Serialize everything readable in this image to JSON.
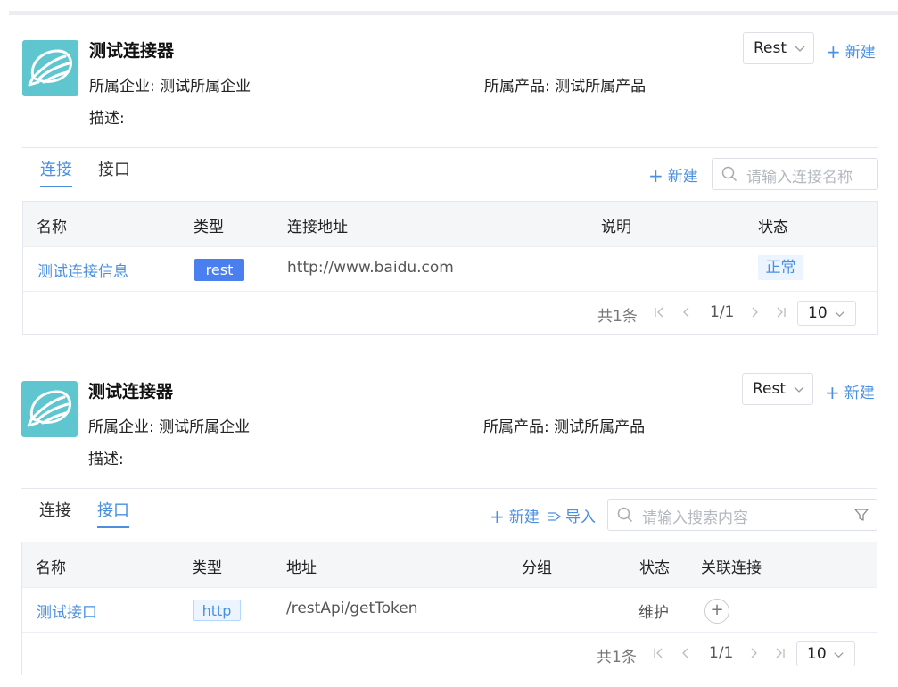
{
  "cards": [
    {
      "title": "测试连接器",
      "company": "所属企业: 测试所属企业",
      "product": "所属产品: 测试所属产品",
      "description": "描述:",
      "type_select": "Rest",
      "new_label": "新建",
      "tabs": [
        "连接",
        "接口"
      ],
      "active_tab": "连接",
      "search_placeholder": "请输入连接名称",
      "columns": [
        "名称",
        "类型",
        "连接地址",
        "说明",
        "状态"
      ],
      "rows": [
        {
          "name": "测试连接信息",
          "type": "rest",
          "address": "http://www.baidu.com",
          "note": "",
          "status": "正常"
        }
      ],
      "pagination": {
        "total": "共1条",
        "page": "1/1",
        "page_size": "10"
      }
    },
    {
      "title": "测试连接器",
      "company": "所属企业: 测试所属企业",
      "product": "所属产品: 测试所属产品",
      "description": "描述:",
      "type_select": "Rest",
      "new_label": "新建",
      "tabs": [
        "连接",
        "接口"
      ],
      "active_tab": "接口",
      "import_label": "导入",
      "search_placeholder": "请输入搜索内容",
      "columns": [
        "名称",
        "类型",
        "地址",
        "分组",
        "状态",
        "关联连接"
      ],
      "rows": [
        {
          "name": "测试接口",
          "type": "http",
          "address": "/restApi/getToken",
          "group": "",
          "status": "维护",
          "link_button": "+"
        }
      ],
      "pagination": {
        "total": "共1条",
        "page": "1/1",
        "page_size": "10"
      }
    }
  ],
  "colors": {
    "accent": "#4a8fe0",
    "logo_bg": "#5fc6cf",
    "tag_blue": "#4a7ff0"
  },
  "icons": [
    "shell-logo-icon",
    "chevron-down-icon",
    "plus-icon",
    "search-icon",
    "import-icon",
    "filter-icon",
    "first-page-icon",
    "prev-page-icon",
    "next-page-icon",
    "last-page-icon"
  ]
}
